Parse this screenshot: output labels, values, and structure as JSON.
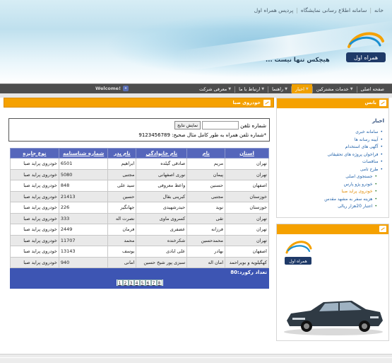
{
  "header": {
    "top_links": [
      "خانه",
      "سامانه اطلاع رسانی نمایشگاه",
      "پردیس همراه اول"
    ],
    "slogan": "هیچکس تنها نیست ...",
    "colors": {
      "accent": "#f5a100",
      "nav": "#4d4d4d",
      "grid_header": "#5566bb"
    }
  },
  "nav": {
    "items": [
      {
        "label": "صفحه اصلی",
        "has_caret": false,
        "active": false
      },
      {
        "label": "خدمات مشترکین",
        "has_caret": true,
        "active": false
      },
      {
        "label": "اخبار",
        "has_caret": true,
        "active": true
      },
      {
        "label": "راهنما",
        "has_caret": true,
        "active": false
      },
      {
        "label": "ارتباط با ما",
        "has_caret": true,
        "active": false
      },
      {
        "label": "معرفی شرکت",
        "has_caret": true,
        "active": false
      }
    ],
    "welcome": "Welcome!"
  },
  "main": {
    "panel_title": "خودروی صبا",
    "phone_label": "شماره تلفن",
    "phone_value": "",
    "show_button": "نمایش نتایج",
    "phone_note": "*شماره تلفن همراه به طور کامل مثال صحیح: 9123456789"
  },
  "grid": {
    "columns": [
      "استان",
      "نام",
      "نام خانوادگی",
      "نام پدر",
      "شماره شناسنامه",
      "نوع جایزه"
    ],
    "rows": [
      [
        "تهران",
        "مریم",
        "صادقی گیلده",
        "ابراهیم",
        "6501",
        "خودروی پراید صبا"
      ],
      [
        "تهران",
        "پیمان",
        "نوری اصفهانی",
        "مجتبی",
        "5080",
        "خودروی پراید صبا"
      ],
      [
        "اصفهان",
        "حسنین",
        "واعظ معروفی",
        "سید علی",
        "848",
        "خودروی پراید صبا"
      ],
      [
        "خوزستان",
        "مجتبی",
        "کبرینی بقال",
        "حسین",
        "21413",
        "خودروی پراید صبا"
      ],
      [
        "خوزستان",
        "نوید",
        "حیدرشهیدی",
        "جهانگیر",
        "226",
        "خودروی پراید صبا"
      ],
      [
        "تهران",
        "تقی",
        "کسروی ماوی",
        "نصرت اله",
        "333",
        "خودروی پراید صبا"
      ],
      [
        "تهران",
        "فرزانه",
        "عضفری",
        "فرمان",
        "2449",
        "خودروی پراید صبا"
      ],
      [
        "تهران",
        "محمدحسین",
        "شکرخنده",
        "محمد",
        "11707",
        "خودروی پراید صبا"
      ],
      [
        "اصفهان",
        "بهادر",
        "علی ابادی",
        "یوسف",
        "13143",
        "خودروی پراید صبا"
      ],
      [
        "کهگیلویه و بویراحمد",
        "امان اله",
        "سبزی پور شیخ حسین",
        "امانی",
        "940",
        "خودروی پراید صبا"
      ]
    ],
    "total_text": "تعداد رکورد:80",
    "pages": [
      "1",
      "2",
      "3",
      "4",
      "5",
      "6",
      "7",
      "8"
    ]
  },
  "sidebar": {
    "panel_title": "بانس",
    "heading": "اخبار",
    "menu": [
      {
        "label": "سامانه خبری",
        "level": 0,
        "current": false
      },
      {
        "label": "آیینه رسانه ها",
        "level": 0,
        "current": false
      },
      {
        "label": "آگهی های استخدام",
        "level": 0,
        "current": false
      },
      {
        "label": "فراخوان پروژه های تحقیقاتی",
        "level": 0,
        "current": false
      },
      {
        "label": "مناقصات",
        "level": 0,
        "current": false
      },
      {
        "label": "طرح تامی",
        "level": 0,
        "current": false
      },
      {
        "label": "جستجوی اصلی",
        "level": 1,
        "current": false
      },
      {
        "label": "خودرو پژو پارس",
        "level": 1,
        "current": false
      },
      {
        "label": "خودروی پراید صبا",
        "level": 1,
        "current": true
      },
      {
        "label": "هزینه سفر به مشهد مقدس",
        "level": 1,
        "current": false
      },
      {
        "label": "اعتبار 20هزار ریالی",
        "level": 1,
        "current": false
      }
    ],
    "ad_panel_title": ""
  }
}
